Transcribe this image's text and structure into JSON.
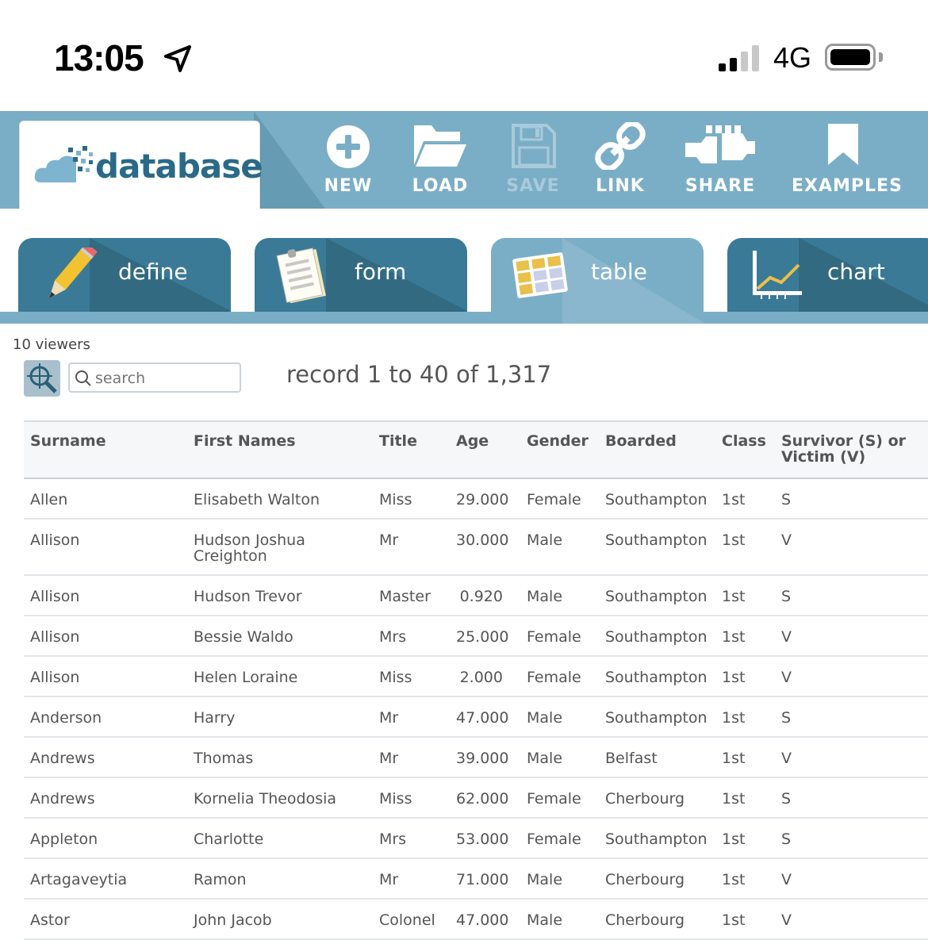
{
  "status": {
    "time": "13:05",
    "network": "4G"
  },
  "toolbar": {
    "logo_text": "database",
    "buttons": [
      {
        "label": "NEW",
        "icon": "plus-circle-icon",
        "enabled": true
      },
      {
        "label": "LOAD",
        "icon": "folder-open-icon",
        "enabled": true
      },
      {
        "label": "SAVE",
        "icon": "floppy-disk-icon",
        "enabled": false
      },
      {
        "label": "LINK",
        "icon": "chain-link-icon",
        "enabled": true
      },
      {
        "label": "SHARE",
        "icon": "share-plug-icon",
        "enabled": true
      },
      {
        "label": "EXAMPLES",
        "icon": "bookmark-icon",
        "enabled": true
      }
    ]
  },
  "tabs": [
    {
      "label": "define",
      "icon": "pencil-icon",
      "active": false
    },
    {
      "label": "form",
      "icon": "notepad-icon",
      "active": false
    },
    {
      "label": "table",
      "icon": "table-grid-icon",
      "active": true
    },
    {
      "label": "chart",
      "icon": "line-chart-icon",
      "active": false
    }
  ],
  "viewers": "10 viewers",
  "search": {
    "placeholder": "search"
  },
  "record_info": "record 1 to 40 of 1,317",
  "table": {
    "headers": [
      "Surname",
      "First Names",
      "Title",
      "Age",
      "Gender",
      "Boarded",
      "Class",
      "Survivor (S) or Victim (V)"
    ],
    "rows": [
      [
        "Allen",
        "Elisabeth Walton",
        "Miss",
        "29.000",
        "Female",
        "Southampton",
        "1st",
        "S"
      ],
      [
        "Allison",
        "Hudson Joshua Creighton",
        "Mr",
        "30.000",
        "Male",
        "Southampton",
        "1st",
        "V"
      ],
      [
        "Allison",
        "Hudson Trevor",
        "Master",
        "0.920",
        "Male",
        "Southampton",
        "1st",
        "S"
      ],
      [
        "Allison",
        "Bessie Waldo",
        "Mrs",
        "25.000",
        "Female",
        "Southampton",
        "1st",
        "V"
      ],
      [
        "Allison",
        "Helen Loraine",
        "Miss",
        "2.000",
        "Female",
        "Southampton",
        "1st",
        "V"
      ],
      [
        "Anderson",
        "Harry",
        "Mr",
        "47.000",
        "Male",
        "Southampton",
        "1st",
        "S"
      ],
      [
        "Andrews",
        "Thomas",
        "Mr",
        "39.000",
        "Male",
        "Belfast",
        "1st",
        "V"
      ],
      [
        "Andrews",
        "Kornelia Theodosia",
        "Miss",
        "62.000",
        "Female",
        "Cherbourg",
        "1st",
        "S"
      ],
      [
        "Appleton",
        "Charlotte",
        "Mrs",
        "53.000",
        "Female",
        "Southampton",
        "1st",
        "S"
      ],
      [
        "Artagaveytia",
        "Ramon",
        "Mr",
        "71.000",
        "Male",
        "Cherbourg",
        "1st",
        "V"
      ],
      [
        "Astor",
        "John Jacob",
        "Colonel",
        "47.000",
        "Male",
        "Cherbourg",
        "1st",
        "V"
      ]
    ]
  },
  "colors": {
    "toolbar": "#7aaec6",
    "tab_dark": "#3a7a96",
    "logo_text": "#2a6a87"
  }
}
